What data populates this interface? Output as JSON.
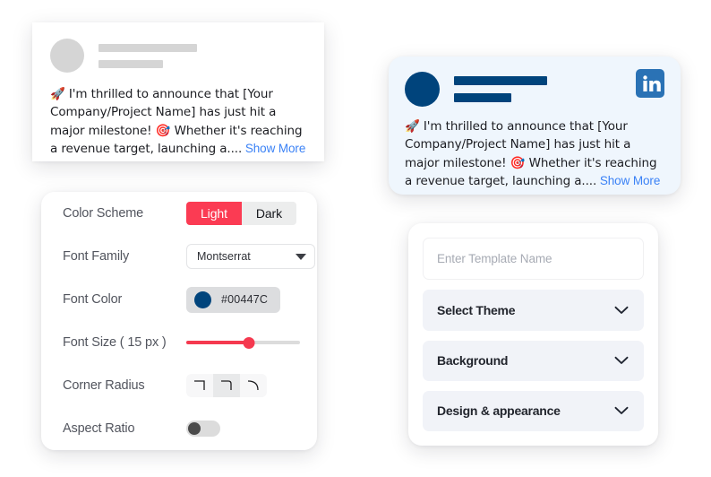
{
  "post_preview_plain": {
    "avatar": "avatar-placeholder",
    "name_line": "",
    "subtitle_line": "",
    "body_text": "🚀 I'm thrilled to announce that [Your Company/Project Name] has just hit a major milestone! 🎯 Whether it's reaching a revenue target, launching a....",
    "show_more_label": "Show More",
    "show_more_color": "#3b82f6",
    "card_background": "#ffffff"
  },
  "post_preview_linkedin": {
    "platform": "LinkedIn",
    "badge_label": "in",
    "body_text": "🚀 I'm thrilled to announce that [Your Company/Project Name] has just hit a major milestone! 🎯 Whether it's reaching a revenue target, launching a....",
    "show_more_label": "Show More",
    "show_more_color": "#3b82f6",
    "card_background": "#eff6fd",
    "accent_color": "#00447C",
    "badge_color": "#2a72b5"
  },
  "settings_panel": {
    "rows": [
      {
        "label": "Color Scheme"
      },
      {
        "label": "Font Family"
      },
      {
        "label": "Font Color"
      },
      {
        "label": "Font Size ( 15 px )"
      },
      {
        "label": "Corner Radius"
      },
      {
        "label": "Aspect Ratio"
      }
    ],
    "color_scheme": {
      "options": [
        "Light",
        "Dark"
      ],
      "selected": "Light",
      "active_color": "#fb3b53",
      "inactive_color": "#eceded"
    },
    "font_family": {
      "value": "Montserrat",
      "options": [
        "Montserrat"
      ]
    },
    "font_color": {
      "value": "#00447C",
      "swatch": "#00447C"
    },
    "font_size": {
      "value": 15,
      "unit": "px",
      "percent": 55,
      "fill_color": "#f5394f",
      "track_color": "#dcdcdc"
    },
    "corner_radius": {
      "options": [
        "sharp",
        "small",
        "large"
      ],
      "selected_index": 1
    },
    "aspect_ratio": {
      "enabled": false
    }
  },
  "template_panel": {
    "name_input": {
      "value": "",
      "placeholder": "Enter Template Name"
    },
    "accordions": [
      {
        "label": "Select Theme",
        "expanded": false
      },
      {
        "label": "Background",
        "expanded": false
      },
      {
        "label": "Design & appearance",
        "expanded": false
      }
    ]
  }
}
